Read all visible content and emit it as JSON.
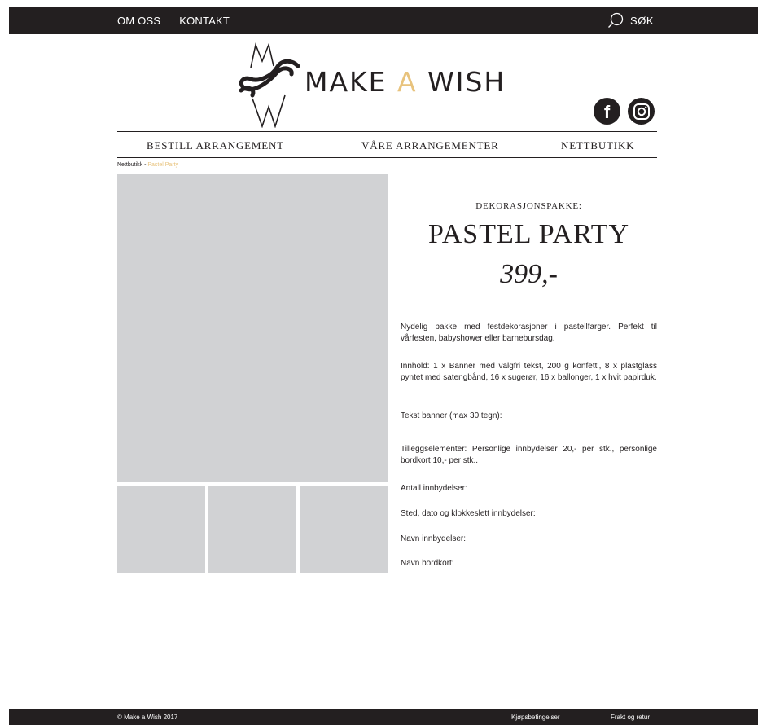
{
  "topnav": {
    "items": [
      "OM OSS",
      "KONTAKT"
    ],
    "search_label": "SØK"
  },
  "logo": {
    "word1": "MAKE ",
    "accent": "A",
    "word2": " WISH"
  },
  "mainnav": {
    "items": [
      "BESTILL ARRANGEMENT",
      "VÅRE ARRANGEMENTER",
      "NETTBUTIKK"
    ]
  },
  "breadcrumb": {
    "parent": "Nettbutikk",
    "separator": " - ",
    "current": "Pastel Party"
  },
  "product": {
    "category": "DEKORASJONSPAKKE:",
    "name": "PASTEL PARTY",
    "price": "399,-",
    "description": "Nydelig pakke med festdekorasjoner i pastellfarger. Perfekt til vårfesten, babyshower eller barnebursdag.",
    "contents": "Innhold: 1 x Banner med valgfri tekst, 200 g konfetti, 8 x plast­glass pyntet med satengbånd, 16 x sugerør, 16 x ballonger, 1 x hvit papirduk.",
    "banner_label": "Tekst banner (max 30 tegn):",
    "extras": "Tilleggselementer: Personlige innbydelser 20,- per stk., person­lige bordkort 10,- per stk..",
    "fields": [
      "Antall innbydelser:",
      "Sted, dato og klokkeslett innbydelser:",
      "Navn innbydelser:",
      "Navn bordkort:"
    ]
  },
  "footer": {
    "copyright": "© Make a Wish 2017",
    "links": [
      "Kjøpsbetingelser",
      "Frakt og retur"
    ]
  },
  "colors": {
    "dark": "#231f20",
    "accent": "#e8c37d",
    "placeholder": "#d1d2d4"
  }
}
